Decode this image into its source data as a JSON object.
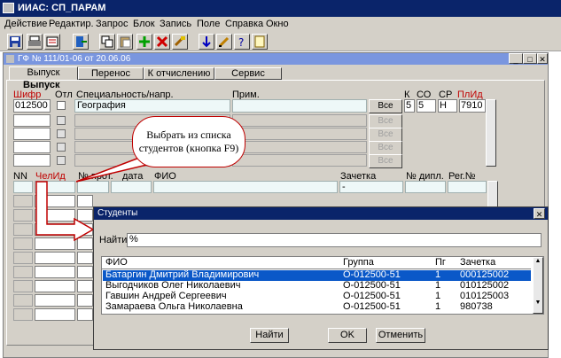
{
  "app": {
    "title": "ИИАС: СП_ПАРАМ"
  },
  "menu": [
    "Действие",
    "Редактир.",
    "Запрос",
    "Блок",
    "Запись",
    "Поле",
    "Справка",
    "Окно"
  ],
  "form": {
    "title": "ГФ  № 111/01-06 от 20.06.06",
    "tabs": [
      "Выпуск",
      "Перенос",
      "К отчислению",
      "Сервис"
    ],
    "group_label": "Выпуск",
    "top_headers": {
      "shifr": "Шифр",
      "otl": "Отл",
      "spec": "Специальность/напр.",
      "prim": "Прим.",
      "k": "К",
      "so": "СО",
      "sr": "СР",
      "plid": "ПлИд"
    },
    "top_row": {
      "shifr": "012500",
      "spec": "География",
      "k": "5",
      "so": "5",
      "sr": "Н",
      "plid": "7910"
    },
    "vse": "Все",
    "lower_headers": {
      "nn": "NN",
      "chelid": "ЧелИд",
      "prot": "№ прот.",
      "data": "дата",
      "fio": "ФИО",
      "zachetka": "Зачетка",
      "dipl": "№ дипл.",
      "reg": "Рег.№"
    },
    "lower_first_zachetka": "-"
  },
  "callout": {
    "text": "Выбрать из списка студентов (кнопка F9)"
  },
  "dialog": {
    "title": "Студенты",
    "find_label": "Найти",
    "find_value": "%",
    "columns": [
      "ФИО",
      "Группа",
      "Пг",
      "Зачетка"
    ],
    "rows": [
      {
        "fio": "Батаргин Дмитрий Владимирович",
        "group": "О-012500-51",
        "pg": "1",
        "zach": "000125002"
      },
      {
        "fio": "Выгодчиков Олег Николаевич",
        "group": "О-012500-51",
        "pg": "1",
        "zach": "010125002"
      },
      {
        "fio": "Гавшин Андрей Сергеевич",
        "group": "О-012500-51",
        "pg": "1",
        "zach": "010125003"
      },
      {
        "fio": "Замараева Ольга Николаевна",
        "group": "О-012500-51",
        "pg": "1",
        "zach": "980738"
      }
    ],
    "buttons": {
      "find": "Найти",
      "ok": "OK",
      "cancel": "Отменить"
    }
  },
  "colors": {
    "title_bar": "#0a246a",
    "selection": "#0a58c8",
    "window_bg": "#d4d0c8",
    "accent_red": "#c00000"
  }
}
